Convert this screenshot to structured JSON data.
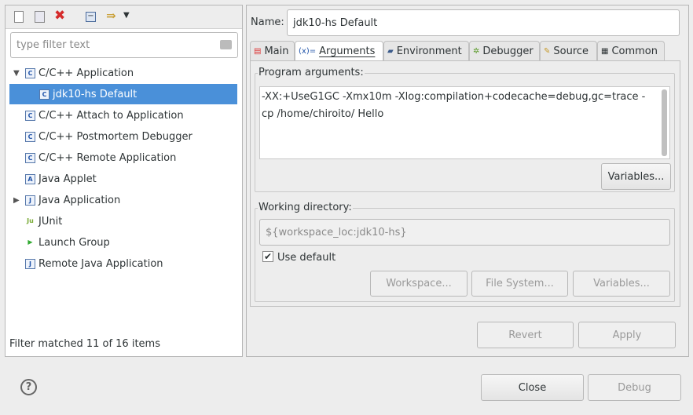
{
  "toolbar": {
    "icons": [
      "new-config-icon",
      "duplicate-icon",
      "delete-icon",
      "collapse-all-icon",
      "filter-icon",
      "dropdown-icon"
    ]
  },
  "filter": {
    "placeholder": "type filter text"
  },
  "tree": [
    {
      "label": "C/C++ Application",
      "expanded": true
    },
    {
      "label": "jdk10-hs Default",
      "selected": true
    },
    {
      "label": "C/C++ Attach to Application"
    },
    {
      "label": "C/C++ Postmortem Debugger"
    },
    {
      "label": "C/C++ Remote Application"
    },
    {
      "label": "Java Applet"
    },
    {
      "label": "Java Application",
      "expandable": true
    },
    {
      "label": "JUnit"
    },
    {
      "label": "Launch Group"
    },
    {
      "label": "Remote Java Application"
    }
  ],
  "filter_status": "Filter matched 11 of 16 items",
  "name_label": "Name:",
  "name_value": "jdk10-hs Default",
  "tabs": [
    {
      "label": "Main"
    },
    {
      "label": "Arguments",
      "active": true
    },
    {
      "label": "Environment"
    },
    {
      "label": "Debugger"
    },
    {
      "label": "Source"
    },
    {
      "label": "Common"
    }
  ],
  "program_args": {
    "label": "Program arguments:",
    "value": "-XX:+UseG1GC -Xmx10m -Xlog:compilation+codecache=debug,gc=trace -cp /home/chiroito/ Hello",
    "variables": "Variables..."
  },
  "working_dir": {
    "label": "Working directory:",
    "value": "${workspace_loc:jdk10-hs}",
    "use_default": "Use default",
    "use_default_checked": true,
    "workspace": "Workspace...",
    "file_system": "File System...",
    "variables": "Variables..."
  },
  "revert": "Revert",
  "apply": "Apply",
  "close": "Close",
  "debug": "Debug",
  "colors": {
    "selection": "#4a90d9"
  }
}
